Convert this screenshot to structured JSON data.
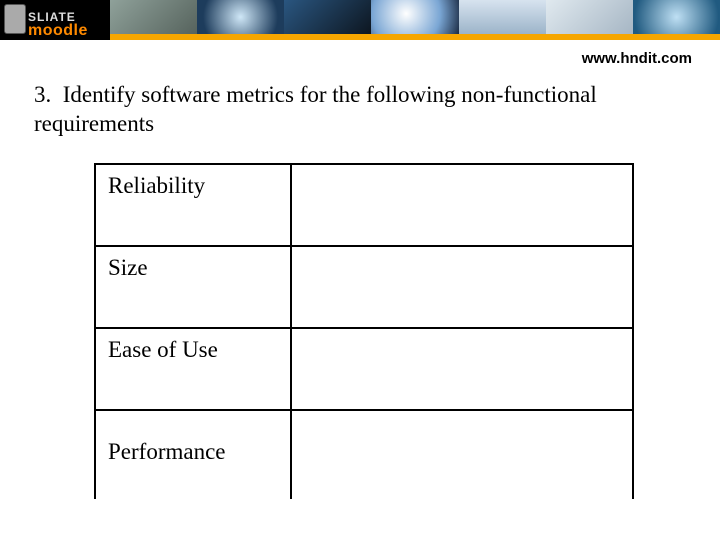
{
  "banner": {
    "logo_line1": "SLIATE",
    "logo_line2": "moodle"
  },
  "url": "www.hndit.com",
  "question": {
    "number": "3.",
    "text": "Identify software metrics for the following non-functional requirements"
  },
  "table": {
    "rows": [
      {
        "label": "Reliability",
        "value": ""
      },
      {
        "label": "Size",
        "value": ""
      },
      {
        "label": "Ease of Use",
        "value": ""
      },
      {
        "label": "Performance",
        "value": ""
      }
    ]
  }
}
